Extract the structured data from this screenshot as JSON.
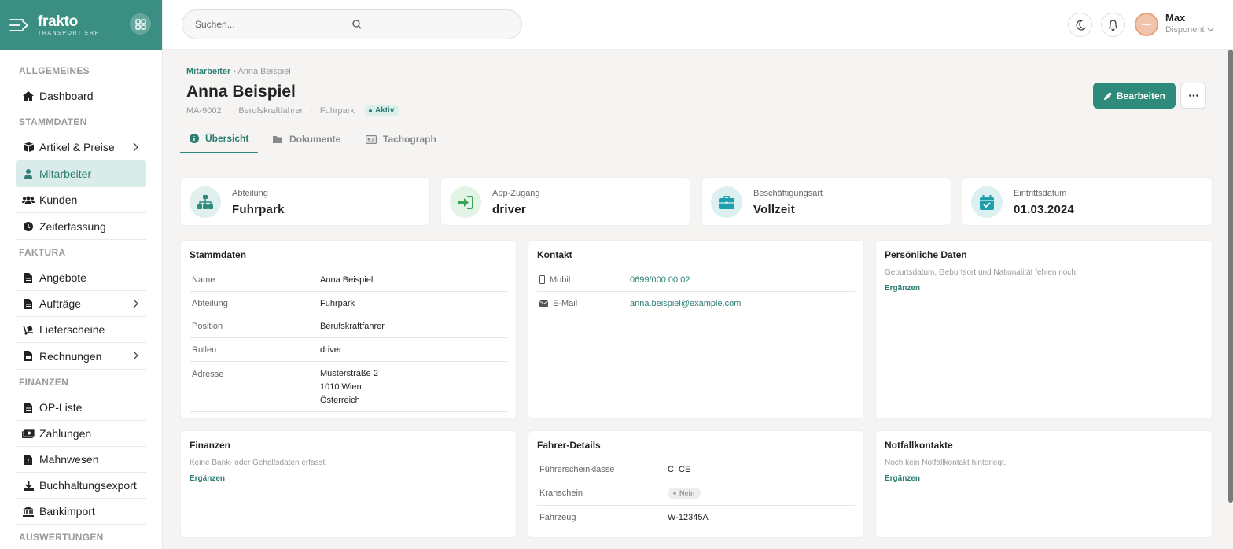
{
  "app": {
    "name": "frakto",
    "subtitle": "TRANSPORT ERP"
  },
  "search": {
    "placeholder": "Suchen..."
  },
  "user": {
    "name": "Max",
    "role": "Disponent"
  },
  "colors": {
    "brand": "#3a8f82",
    "accent": "#2e8a7a",
    "active_bg": "#d9ece9"
  },
  "sidebar": {
    "sections": [
      {
        "label": "ALLGEMEINES",
        "items": [
          {
            "label": "Dashboard",
            "icon": "home-icon"
          }
        ]
      },
      {
        "label": "STAMMDATEN",
        "items": [
          {
            "label": "Artikel & Preise",
            "icon": "box-icon",
            "chevron": true
          },
          {
            "label": "Mitarbeiter",
            "icon": "person-icon",
            "active": true
          },
          {
            "label": "Kunden",
            "icon": "users-icon"
          },
          {
            "label": "Zeiterfassung",
            "icon": "clock-icon"
          }
        ]
      },
      {
        "label": "FAKTURA",
        "items": [
          {
            "label": "Angebote",
            "icon": "file-icon"
          },
          {
            "label": "Aufträge",
            "icon": "file-icon",
            "chevron": true
          },
          {
            "label": "Lieferscheine",
            "icon": "dolly-icon"
          },
          {
            "label": "Rechnungen",
            "icon": "invoice-icon",
            "chevron": true
          }
        ]
      },
      {
        "label": "FINANZEN",
        "items": [
          {
            "label": "OP-Liste",
            "icon": "file-icon"
          },
          {
            "label": "Zahlungen",
            "icon": "money-icon"
          },
          {
            "label": "Mahnwesen",
            "icon": "file-icon"
          },
          {
            "label": "Buchhaltungsexport",
            "icon": "download-icon"
          },
          {
            "label": "Bankimport",
            "icon": "bank-icon"
          }
        ]
      },
      {
        "label": "AUSWERTUNGEN",
        "items": []
      }
    ]
  },
  "page": {
    "breadcrumb_parent": "Mitarbeiter",
    "breadcrumb_sep": "›",
    "breadcrumb_current": "Anna Beispiel",
    "title": "Anna Beispiel",
    "meta": {
      "id": "MA-9002",
      "position": "Berufskraftfahrer",
      "department": "Fuhrpark",
      "status": "Aktiv",
      "sep": "·"
    },
    "edit_label": "Bearbeiten",
    "tabs": [
      {
        "label": "Übersicht",
        "icon": "info-icon",
        "active": true
      },
      {
        "label": "Dokumente",
        "icon": "folder-icon"
      },
      {
        "label": "Tachograph",
        "icon": "id-card-icon"
      }
    ]
  },
  "stats": [
    {
      "label": "Abteilung",
      "value": "Fuhrpark",
      "icon": "sitemap-icon"
    },
    {
      "label": "App-Zugang",
      "value": "driver",
      "icon": "sign-in-icon"
    },
    {
      "label": "Beschäftigungsart",
      "value": "Vollzeit",
      "icon": "briefcase-icon"
    },
    {
      "label": "Eintrittsdatum",
      "value": "01.03.2024",
      "icon": "calendar-check-icon"
    }
  ],
  "stammdaten": {
    "title": "Stammdaten",
    "rows": [
      {
        "k": "Name",
        "v": "Anna Beispiel"
      },
      {
        "k": "Abteilung",
        "v": "Fuhrpark"
      },
      {
        "k": "Position",
        "v": "Berufskraftfahrer"
      },
      {
        "k": "Rollen",
        "v": "driver"
      },
      {
        "k": "Adresse",
        "v1": "Musterstraße 2",
        "v2": "1010 Wien",
        "v3": "Österreich"
      }
    ]
  },
  "kontakt": {
    "title": "Kontakt",
    "mobile_label": "Mobil",
    "mobile": "0699/000 00 02",
    "email_label": "E-Mail",
    "email": "anna.beispiel@example.com"
  },
  "persoenlich": {
    "title": "Persönliche Daten",
    "note": "Geburtsdatum, Geburtsort und Nationalität fehlen noch.",
    "action": "Ergänzen"
  },
  "finanzen": {
    "title": "Finanzen",
    "note": "Keine Bank- oder Gehaltsdaten erfasst.",
    "action": "Ergänzen"
  },
  "fahrer": {
    "title": "Fahrer-Details",
    "license_label": "Führerscheinklasse",
    "license": "C, CE",
    "crane_label": "Kranschein",
    "crane": "Nein",
    "vehicle_label": "Fahrzeug",
    "vehicle": "W-12345A"
  },
  "notfall": {
    "title": "Notfallkontakte",
    "note": "Noch kein Notfallkontakt hinterlegt.",
    "action": "Ergänzen"
  }
}
